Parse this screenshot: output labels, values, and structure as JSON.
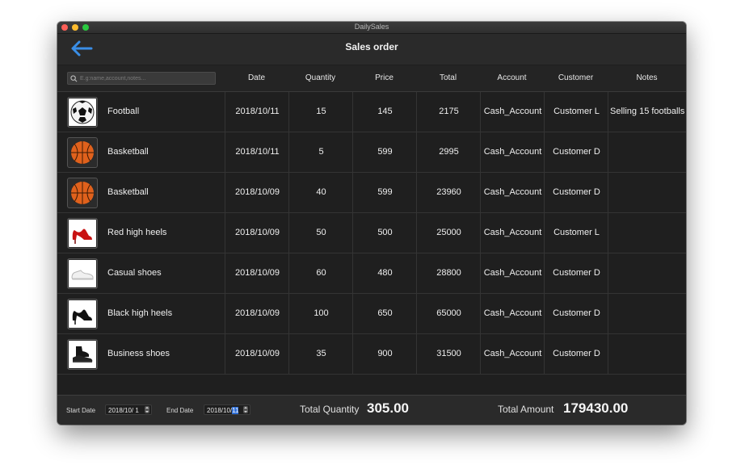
{
  "window": {
    "title": "DailySales"
  },
  "toolbar": {
    "title": "Sales order"
  },
  "search": {
    "placeholder": "E.g:name,account,notes..."
  },
  "columns": [
    "Date",
    "Quantity",
    "Price",
    "Total",
    "Account",
    "Customer",
    "Notes"
  ],
  "orders": [
    {
      "product": "Football",
      "icon": "football-icon",
      "date": "2018/10/11",
      "quantity": "15",
      "price": "145",
      "total": "2175",
      "account": "Cash_Account",
      "customer": "Customer L",
      "notes": "Selling 15 footballs"
    },
    {
      "product": "Basketball",
      "icon": "basketball-icon",
      "date": "2018/10/11",
      "quantity": "5",
      "price": "599",
      "total": "2995",
      "account": "Cash_Account",
      "customer": "Customer D",
      "notes": ""
    },
    {
      "product": "Basketball",
      "icon": "basketball-icon",
      "date": "2018/10/09",
      "quantity": "40",
      "price": "599",
      "total": "23960",
      "account": "Cash_Account",
      "customer": "Customer D",
      "notes": ""
    },
    {
      "product": "Red high heels",
      "icon": "red-high-heel-icon",
      "date": "2018/10/09",
      "quantity": "50",
      "price": "500",
      "total": "25000",
      "account": "Cash_Account",
      "customer": "Customer L",
      "notes": ""
    },
    {
      "product": "Casual shoes",
      "icon": "casual-shoe-icon",
      "date": "2018/10/09",
      "quantity": "60",
      "price": "480",
      "total": "28800",
      "account": "Cash_Account",
      "customer": "Customer D",
      "notes": ""
    },
    {
      "product": "Black high heels",
      "icon": "black-high-heel-icon",
      "date": "2018/10/09",
      "quantity": "100",
      "price": "650",
      "total": "65000",
      "account": "Cash_Account",
      "customer": "Customer D",
      "notes": ""
    },
    {
      "product": "Business shoes",
      "icon": "business-shoe-icon",
      "date": "2018/10/09",
      "quantity": "35",
      "price": "900",
      "total": "31500",
      "account": "Cash_Account",
      "customer": "Customer D",
      "notes": ""
    }
  ],
  "footer": {
    "start_label": "Start Date",
    "start_prefix": "2018/10/",
    "start_day": " 1",
    "end_label": "End Date",
    "end_prefix": "2018/10/",
    "end_day": "11",
    "total_quantity_label": "Total Quantity",
    "total_quantity": "305.00",
    "total_amount_label": "Total Amount",
    "total_amount": "179430.00"
  },
  "colors": {
    "accent": "#3a8ee6",
    "selection": "#2f6fd6",
    "background": "#1f1f1f"
  }
}
